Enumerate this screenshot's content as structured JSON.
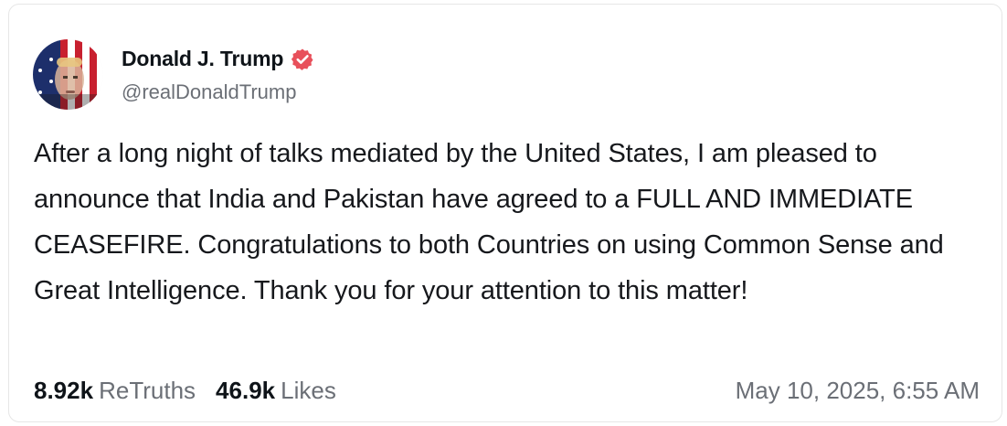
{
  "post": {
    "author": {
      "name": "Donald J. Trump",
      "handle": "@realDonaldTrump",
      "avatar_icon": "flag-portrait-avatar",
      "verified_icon": "verified-badge-icon"
    },
    "text": "After a long night of talks mediated by the United States, I am pleased to announce that India and Pakistan have agreed to a FULL AND IMMEDIATE CEASEFIRE. Congratulations to both Countries on using Common Sense and Great Intelligence. Thank you for your attention to this matter!",
    "stats": {
      "retruths_count": "8.92k",
      "retruths_label": "ReTruths",
      "likes_count": "46.9k",
      "likes_label": "Likes"
    },
    "timestamp": "May 10, 2025, 6:55 AM"
  },
  "colors": {
    "verified_badge": "#e8505b",
    "secondary_text": "#6b6f76",
    "primary_text": "#0f1419"
  }
}
